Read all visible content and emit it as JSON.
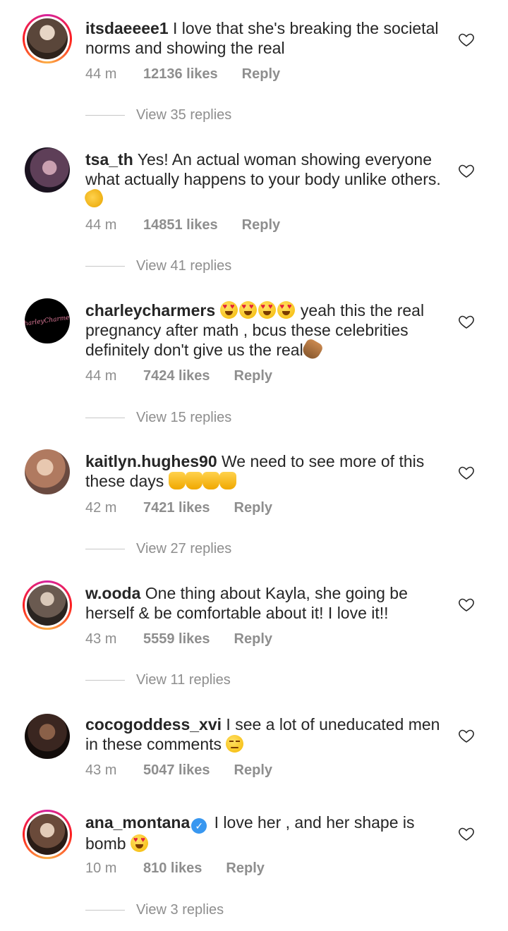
{
  "comments": [
    {
      "username": "itsdaeeee1",
      "text": "I love that she's breaking the societal norms and showing the real",
      "time": "44 m",
      "likes": "12136 likes",
      "reply_label": "Reply",
      "replies": "View 35 replies",
      "avatar_colors": [
        "#c9b8a6",
        "#6b5444"
      ]
    },
    {
      "username": "tsa_th",
      "text": "Yes! An actual woman showing everyone what actually happens to your body unlike others.",
      "time": "44 m",
      "likes": "14851 likes",
      "reply_label": "Reply",
      "replies": "View 41 replies",
      "avatar_colors": [
        "#8a6a8a",
        "#2a1e2a"
      ]
    },
    {
      "username": "charleycharmers",
      "text_after": "yeah this the real pregnancy after math , bcus these celebrities definitely don't give us the real",
      "avatar_script": "CharleyCharmers",
      "time": "44 m",
      "likes": "7424 likes",
      "reply_label": "Reply",
      "replies": "View 15 replies",
      "avatar_colors": [
        "#000000",
        "#e07a9a"
      ]
    },
    {
      "username": "kaitlyn.hughes90",
      "text": "We need to see more of this these days",
      "time": "42 m",
      "likes": "7421 likes",
      "reply_label": "Reply",
      "replies": "View 27 replies",
      "avatar_colors": [
        "#d8b49a",
        "#9a6a55"
      ]
    },
    {
      "username": "w.ooda",
      "text": "One thing about Kayla, she going be herself & be comfortable about it! I love it!!",
      "time": "43 m",
      "likes": "5559 likes",
      "reply_label": "Reply",
      "replies": "View 11 replies",
      "avatar_colors": [
        "#b0a8a0",
        "#3a3430"
      ]
    },
    {
      "username": "cocogoddess_xvi",
      "text": "I see a lot of uneducated men in these comments",
      "time": "43 m",
      "likes": "5047 likes",
      "reply_label": "Reply",
      "avatar_colors": [
        "#6a4a3a",
        "#1a1210"
      ]
    },
    {
      "username": "ana_montana",
      "verified_icon": "verified-badge-icon",
      "text": "I love her , and her shape is bomb",
      "time": "10 m",
      "likes": "810 likes",
      "reply_label": "Reply",
      "replies": "View 3 replies",
      "avatar_colors": [
        "#d9c2b0",
        "#4a342a"
      ]
    }
  ],
  "icons": {
    "like": "heart-outline-icon"
  },
  "colors": {
    "username": "#262626",
    "meta": "#8e8e8e",
    "story_ring": [
      "#d6249f",
      "#fd1d1d",
      "#fcb045"
    ],
    "verified": "#3897f0"
  }
}
